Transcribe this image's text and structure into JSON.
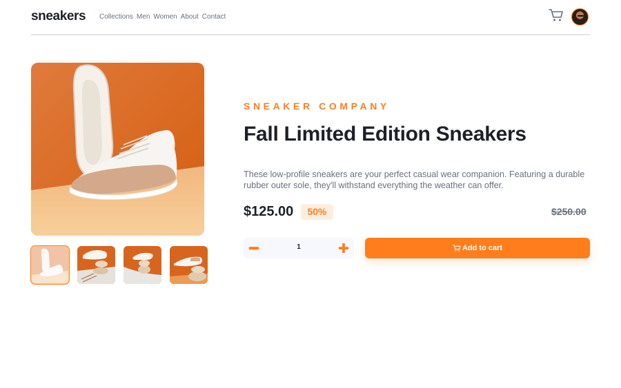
{
  "header": {
    "logo": "sneakers",
    "nav": [
      "Collections",
      "Men",
      "Women",
      "About",
      "Contact"
    ],
    "cart_icon": "cart-icon",
    "avatar_icon": "avatar"
  },
  "gallery": {
    "main_image": "sneaker-product-photo",
    "thumbnails": [
      "thumbnail-1",
      "thumbnail-2",
      "thumbnail-3",
      "thumbnail-4"
    ],
    "active_thumbnail": 1
  },
  "product": {
    "company": "SNEAKER COMPANY",
    "title": "Fall Limited Edition Sneakers",
    "description": "These low-profile sneakers are your perfect casual wear companion. Featuring a durable rubber outer sole, they'll withstand everything the weather can offer.",
    "price": "$125.00",
    "discount": "50%",
    "original_price": "$250.00"
  },
  "cart": {
    "quantity": "1",
    "add_to_cart_label": "Add to cart"
  },
  "colors": {
    "accent": "#ff7e1b",
    "accent_pale": "#ffede0",
    "text_dark": "#1d2026",
    "text_muted": "#69707d"
  }
}
